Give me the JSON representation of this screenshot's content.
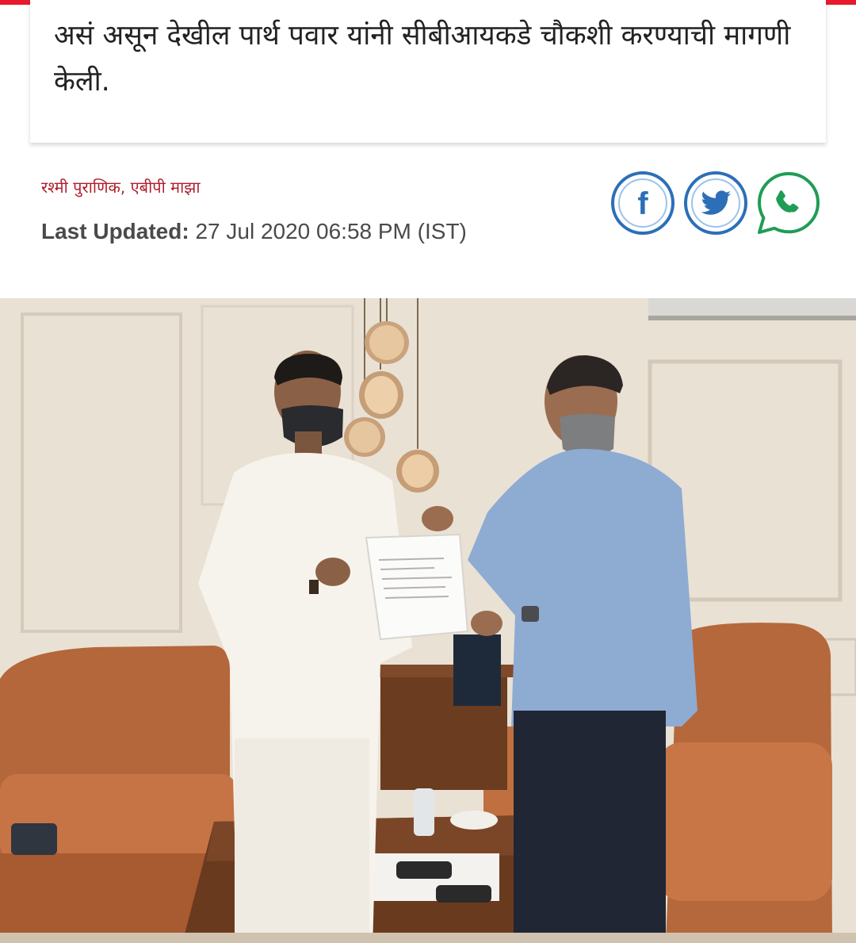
{
  "article": {
    "summary": "असं असून देखील पार्थ पवार यांनी सीबीआयकडे चौकशी करण्याची मागणी केली.",
    "author": "रश्मी पुराणिक, एबीपी माझा",
    "updated_label": "Last Updated:",
    "updated_value": "27 Jul 2020 06:58 PM (IST)"
  },
  "share": {
    "icons": [
      "facebook-icon",
      "twitter-icon",
      "whatsapp-icon"
    ]
  },
  "colors": {
    "brand_red": "#e8192c",
    "author_red": "#b01e2d",
    "share_blue": "#2c6fb8",
    "whatsapp_green": "#1f9d55"
  }
}
